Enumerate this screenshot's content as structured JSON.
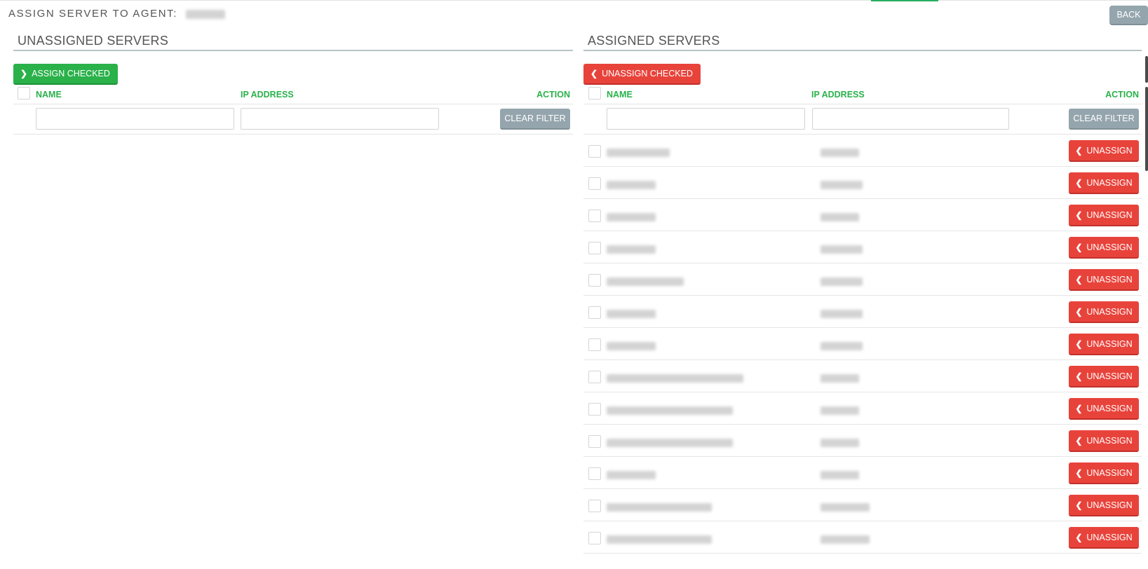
{
  "header": {
    "title": "ASSIGN SERVER TO AGENT:",
    "back_label": "BACK"
  },
  "unassigned": {
    "title": "UNASSIGNED SERVERS",
    "assign_checked_label": "ASSIGN CHECKED",
    "col_name": "NAME",
    "col_ip": "IP ADDRESS",
    "col_action": "ACTION",
    "name_filter": {
      "value": "",
      "placeholder": ""
    },
    "ip_filter": {
      "value": "",
      "placeholder": ""
    },
    "clear_filter_label": "CLEAR FILTER",
    "rows": []
  },
  "assigned": {
    "title": "ASSIGNED SERVERS",
    "unassign_checked_label": "UNASSIGN CHECKED",
    "col_name": "NAME",
    "col_ip": "IP ADDRESS",
    "col_action": "ACTION",
    "name_filter": {
      "value": "",
      "placeholder": ""
    },
    "ip_filter": {
      "value": "",
      "placeholder": ""
    },
    "clear_filter_label": "CLEAR FILTER",
    "unassign_label": "UNASSIGN",
    "rows": [
      {
        "name": "",
        "ip": ""
      },
      {
        "name": "",
        "ip": ""
      },
      {
        "name": "",
        "ip": ""
      },
      {
        "name": "",
        "ip": ""
      },
      {
        "name": "",
        "ip": ""
      },
      {
        "name": "",
        "ip": ""
      },
      {
        "name": "",
        "ip": ""
      },
      {
        "name": "",
        "ip": ""
      },
      {
        "name": "",
        "ip": ""
      },
      {
        "name": "",
        "ip": ""
      },
      {
        "name": "",
        "ip": ""
      },
      {
        "name": "",
        "ip": ""
      },
      {
        "name": "",
        "ip": ""
      }
    ]
  },
  "colors": {
    "green": "#2ab14a",
    "red": "#e8433b",
    "gray_button": "#95a5ad"
  },
  "icons": {
    "assign": "chevron-right-icon",
    "unassign": "chevron-left-icon"
  }
}
